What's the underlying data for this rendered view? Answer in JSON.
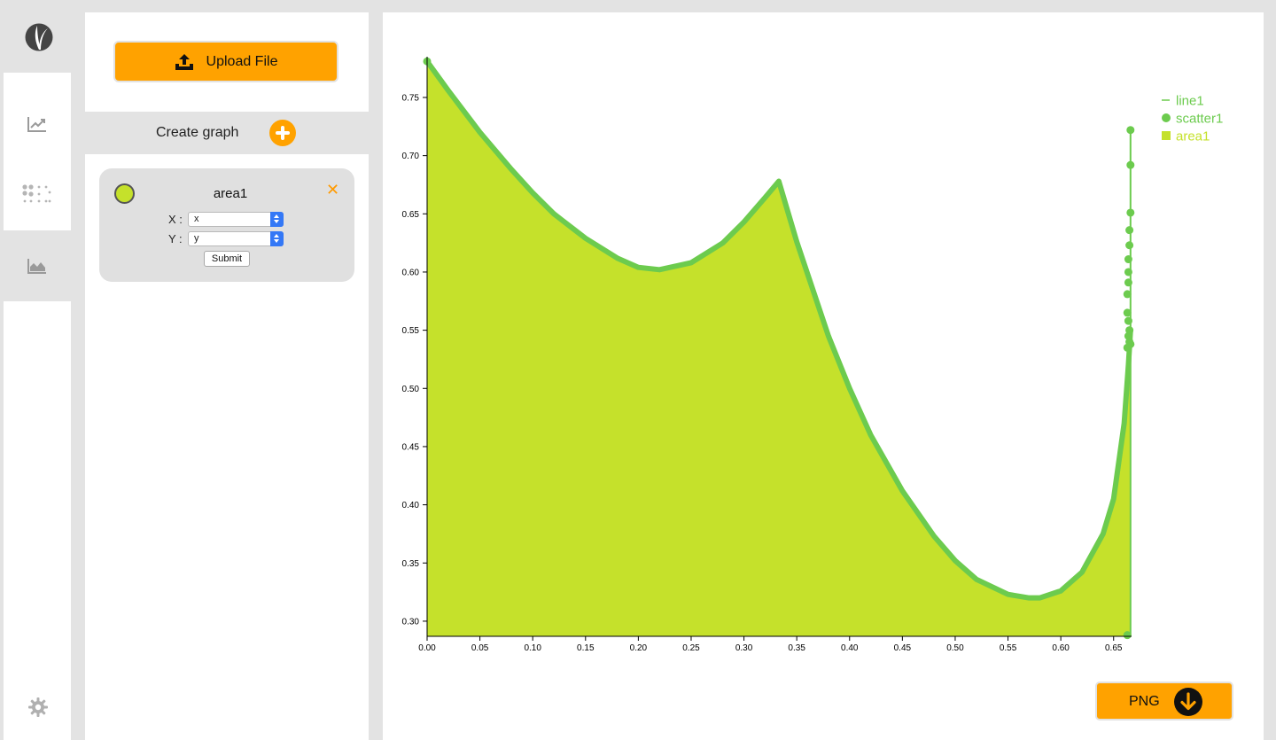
{
  "rail": {
    "items": [
      {
        "name": "line-chart-icon",
        "selected": false
      },
      {
        "name": "scatter-plot-icon",
        "selected": false
      },
      {
        "name": "area-chart-icon",
        "selected": true
      }
    ],
    "settings_icon": "gear-icon"
  },
  "panel": {
    "upload_label": "Upload File",
    "create_label": "Create graph",
    "card": {
      "title": "area1",
      "color": "#c5e12b",
      "x_label": "X :",
      "y_label": "Y :",
      "x_value": "x",
      "y_value": "y",
      "submit_label": "Submit",
      "close_symbol": "✕"
    }
  },
  "export": {
    "label": "PNG"
  },
  "colors": {
    "accent": "#ffa200",
    "line": "#6ccb4e",
    "area": "#c5e12b",
    "scatter": "#6ccb4e"
  },
  "chart_data": {
    "type": "area",
    "title": "",
    "xlabel": "",
    "ylabel": "",
    "xlim": [
      0.0,
      0.667
    ],
    "ylim": [
      0.287,
      0.785
    ],
    "x_ticks": [
      "0.00",
      "0.05",
      "0.10",
      "0.15",
      "0.20",
      "0.25",
      "0.30",
      "0.35",
      "0.40",
      "0.45",
      "0.50",
      "0.55",
      "0.60",
      "0.65"
    ],
    "y_ticks": [
      "0.30",
      "0.35",
      "0.40",
      "0.45",
      "0.50",
      "0.55",
      "0.60",
      "0.65",
      "0.70",
      "0.75"
    ],
    "legend_position": "top-right",
    "grid": false,
    "series": [
      {
        "name": "line1",
        "kind": "line",
        "x": [
          0.0,
          0.02,
          0.05,
          0.08,
          0.1,
          0.12,
          0.15,
          0.18,
          0.2,
          0.22,
          0.25,
          0.28,
          0.3,
          0.32,
          0.333,
          0.35,
          0.38,
          0.4,
          0.42,
          0.45,
          0.48,
          0.5,
          0.52,
          0.55,
          0.57,
          0.58,
          0.6,
          0.62,
          0.64,
          0.65,
          0.66,
          0.664,
          0.666
        ],
        "y": [
          0.781,
          0.756,
          0.72,
          0.688,
          0.668,
          0.65,
          0.629,
          0.612,
          0.604,
          0.602,
          0.608,
          0.625,
          0.643,
          0.664,
          0.678,
          0.626,
          0.545,
          0.5,
          0.46,
          0.412,
          0.373,
          0.352,
          0.336,
          0.323,
          0.32,
          0.32,
          0.326,
          0.342,
          0.375,
          0.405,
          0.47,
          0.52,
          0.55
        ]
      },
      {
        "name": "scatter1",
        "kind": "scatter",
        "x": [
          0.0,
          0.666,
          0.666,
          0.666,
          0.665,
          0.665,
          0.664,
          0.664,
          0.664,
          0.663,
          0.663,
          0.664,
          0.665,
          0.664,
          0.665,
          0.663,
          0.666,
          0.663
        ],
        "y": [
          0.781,
          0.722,
          0.692,
          0.651,
          0.636,
          0.623,
          0.611,
          0.6,
          0.591,
          0.581,
          0.565,
          0.558,
          0.55,
          0.545,
          0.54,
          0.535,
          0.538,
          0.288
        ]
      },
      {
        "name": "area1",
        "kind": "area",
        "x": [
          0.0,
          0.02,
          0.05,
          0.08,
          0.1,
          0.12,
          0.15,
          0.18,
          0.2,
          0.22,
          0.25,
          0.28,
          0.3,
          0.32,
          0.333,
          0.35,
          0.38,
          0.4,
          0.42,
          0.45,
          0.48,
          0.5,
          0.52,
          0.55,
          0.57,
          0.58,
          0.6,
          0.62,
          0.64,
          0.65,
          0.66,
          0.664,
          0.666
        ],
        "y": [
          0.781,
          0.756,
          0.72,
          0.688,
          0.668,
          0.65,
          0.629,
          0.612,
          0.604,
          0.602,
          0.608,
          0.625,
          0.643,
          0.664,
          0.678,
          0.626,
          0.545,
          0.5,
          0.46,
          0.412,
          0.373,
          0.352,
          0.336,
          0.323,
          0.32,
          0.32,
          0.326,
          0.342,
          0.375,
          0.405,
          0.47,
          0.52,
          0.55
        ]
      }
    ]
  }
}
